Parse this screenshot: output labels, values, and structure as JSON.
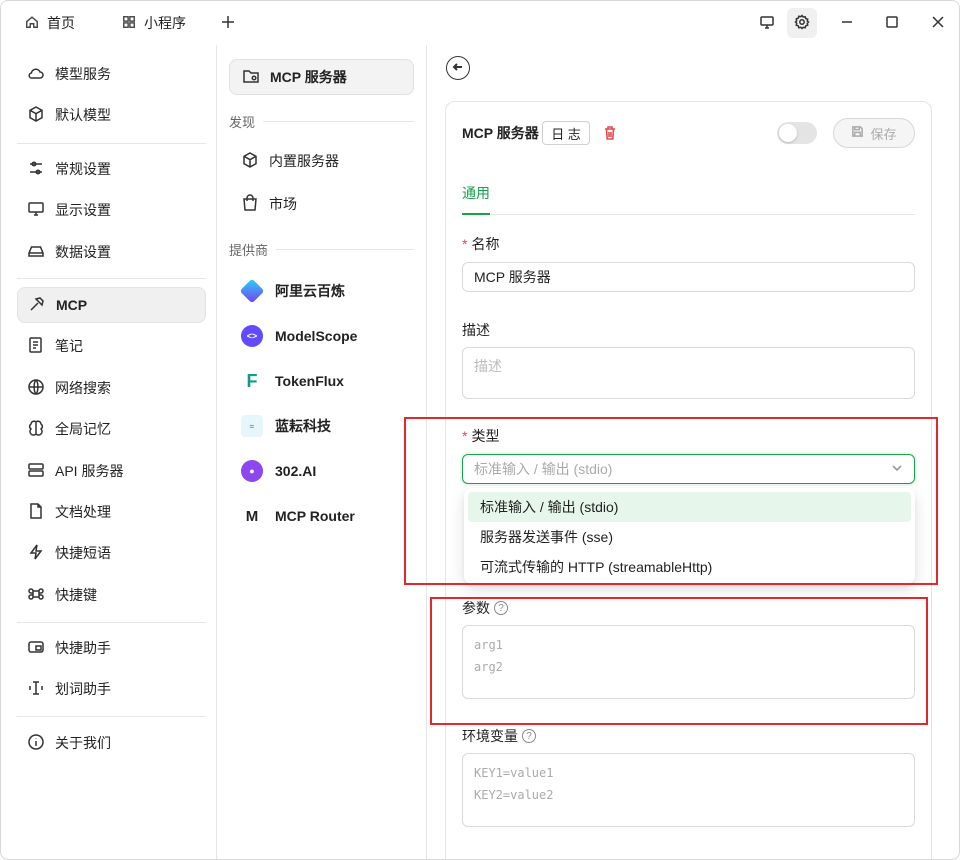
{
  "titlebar": {
    "tabs": [
      {
        "label": "首页",
        "icon": "home-icon"
      },
      {
        "label": "小程序",
        "icon": "grid-icon"
      }
    ],
    "new_tab_icon": "plus-icon",
    "controls": [
      "monitor-icon",
      "gear-icon",
      "minimize-icon",
      "maximize-icon",
      "close-icon"
    ]
  },
  "sidebar": {
    "items": [
      {
        "label": "模型服务",
        "icon": "cloud-icon"
      },
      {
        "label": "默认模型",
        "icon": "cube-icon"
      },
      {
        "label": "常规设置",
        "icon": "sliders-icon"
      },
      {
        "label": "显示设置",
        "icon": "display-icon"
      },
      {
        "label": "数据设置",
        "icon": "drive-icon"
      },
      {
        "label": "MCP",
        "icon": "hammer-icon",
        "active": true
      },
      {
        "label": "笔记",
        "icon": "note-icon"
      },
      {
        "label": "网络搜索",
        "icon": "globe-icon"
      },
      {
        "label": "全局记忆",
        "icon": "brain-icon"
      },
      {
        "label": "API 服务器",
        "icon": "server-icon"
      },
      {
        "label": "文档处理",
        "icon": "document-icon"
      },
      {
        "label": "快捷短语",
        "icon": "zap-icon"
      },
      {
        "label": "快捷键",
        "icon": "command-icon"
      },
      {
        "label": "快捷助手",
        "icon": "assistant-icon"
      },
      {
        "label": "划词助手",
        "icon": "text-cursor-icon"
      },
      {
        "label": "关于我们",
        "icon": "info-icon"
      }
    ]
  },
  "midcol": {
    "servers_item": "MCP 服务器",
    "discover_section": "发现",
    "builtin": "内置服务器",
    "market": "市场",
    "providers_section": "提供商",
    "providers": [
      {
        "label": "阿里云百炼",
        "color": "#5b6cf0"
      },
      {
        "label": "ModelScope",
        "color": "#624aff"
      },
      {
        "label": "TokenFlux",
        "color": "#0f9b8e"
      },
      {
        "label": "蓝耘科技",
        "color": "#27a9c7"
      },
      {
        "label": "302.AI",
        "color": "#8e47f0"
      },
      {
        "label": "MCP Router",
        "color": "#222222"
      }
    ]
  },
  "detail": {
    "title": "MCP 服务器",
    "log_button": "日 志",
    "save_button": "保存",
    "enabled": false,
    "tab_general": "通用",
    "name_label": "名称",
    "name_value": "MCP 服务器",
    "desc_label": "描述",
    "desc_placeholder": "描述",
    "type_label": "类型",
    "type_placeholder": "标准输入 / 输出 (stdio)",
    "type_options": [
      "标准输入 / 输出 (stdio)",
      "服务器发送事件 (sse)",
      "可流式传输的 HTTP (streamableHttp)"
    ],
    "args_label": "参数",
    "args_placeholder_lines": [
      "arg1",
      "arg2"
    ],
    "env_label": "环境变量",
    "env_placeholder_lines": [
      "KEY1=value1",
      "KEY2=value2"
    ],
    "help_glyph": "?",
    "required_mark": "*"
  },
  "colors": {
    "accent": "#16a34a",
    "danger": "#e5484d",
    "highlight_box": "#e0282e"
  }
}
